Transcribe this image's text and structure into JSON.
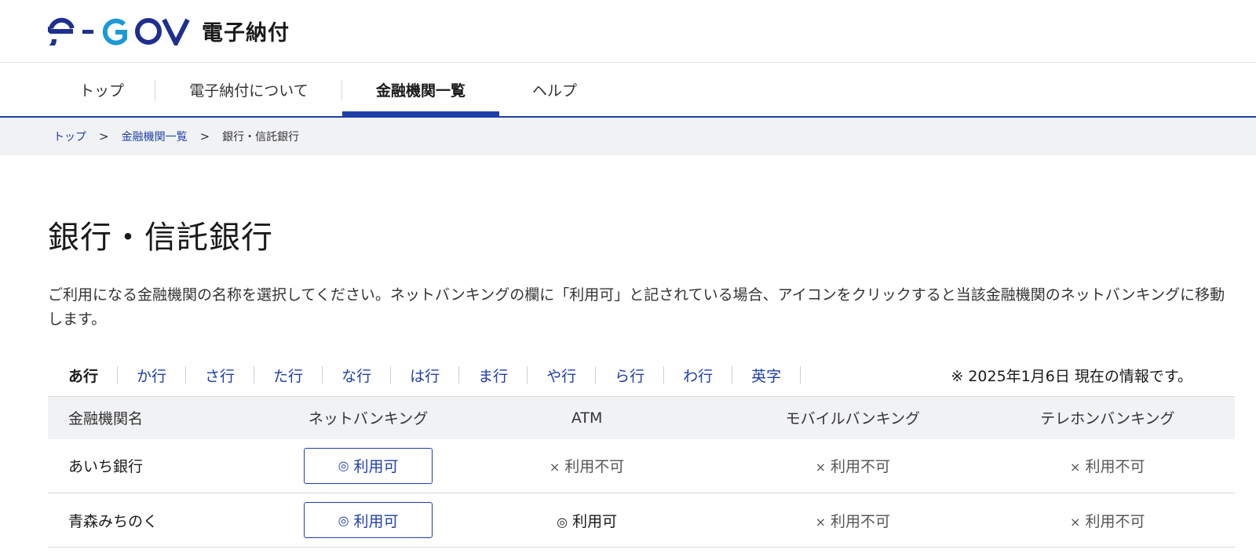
{
  "header": {
    "logo_text": "電子納付",
    "colors": {
      "brand_blue": "#1e3fa8",
      "logo_light_blue": "#1c9ad6"
    }
  },
  "nav": {
    "items": [
      {
        "label": "トップ"
      },
      {
        "label": "電子納付について"
      },
      {
        "label": "金融機関一覧",
        "active": true
      },
      {
        "label": "ヘルプ"
      }
    ]
  },
  "breadcrumb": {
    "items": [
      "トップ",
      "金融機関一覧"
    ],
    "separator": ">",
    "current": "銀行・信託銀行"
  },
  "main": {
    "title": "銀行・信託銀行",
    "lead": "ご利用になる金融機関の名称を選択してください。ネットバンキングの欄に「利用可」と記されている場合、アイコンをクリックすると当該金融機関のネットバンキングに移動します。"
  },
  "kana_tabs": {
    "items": [
      "あ行",
      "か行",
      "さ行",
      "た行",
      "な行",
      "は行",
      "ま行",
      "や行",
      "ら行",
      "わ行",
      "英字"
    ],
    "current": "あ行",
    "info_note": "※ 2025年1月6日 現在の情報です。"
  },
  "table": {
    "headers": [
      "金融機関名",
      "ネットバンキング",
      "ATM",
      "モバイルバンキング",
      "テレホンバンキング"
    ],
    "available_mark": "◎",
    "unavailable_mark": "×",
    "rows": [
      {
        "name": "あいち銀行",
        "net": "利用可",
        "atm": "利用不可",
        "mobile": "利用不可",
        "tel": "利用不可"
      },
      {
        "name": "青森みちのく",
        "net": "利用可",
        "atm": "利用可",
        "mobile": "利用不可",
        "tel": "利用不可"
      }
    ]
  }
}
